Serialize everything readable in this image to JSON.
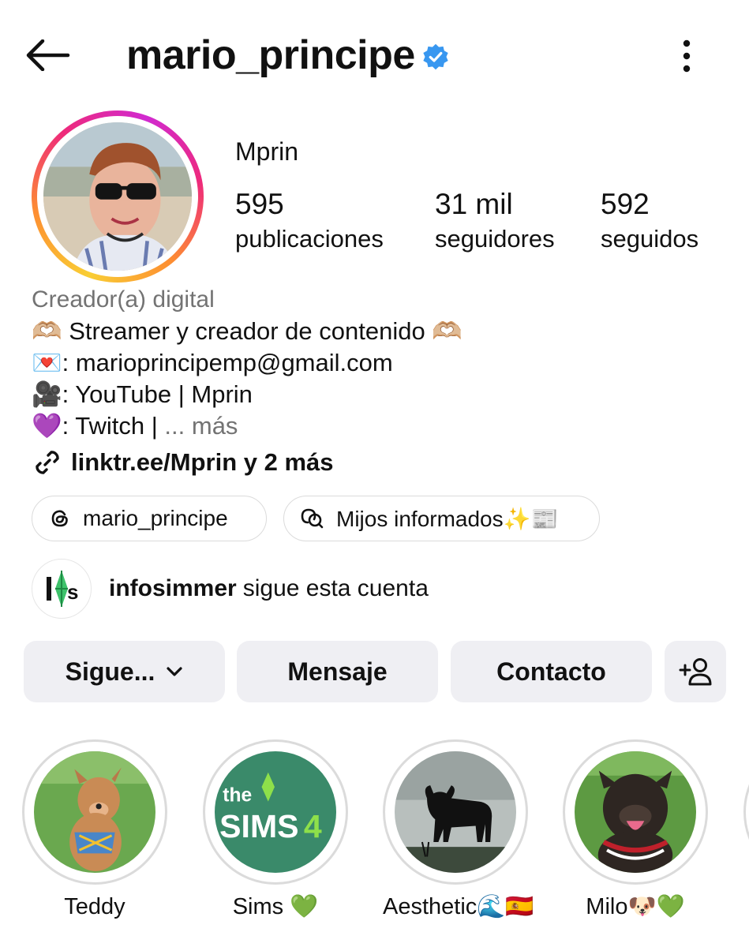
{
  "header": {
    "username": "mario_principe",
    "verified_icon": "verified-badge-icon",
    "back_icon": "arrow-left-icon",
    "more_icon": "more-vertical-icon"
  },
  "profile": {
    "display_name": "Mprin",
    "stats": {
      "posts": {
        "value": "595",
        "label": "publicaciones"
      },
      "followers": {
        "value": "31 mil",
        "label": "seguidores"
      },
      "following": {
        "value": "592",
        "label": "seguidos"
      }
    }
  },
  "bio": {
    "category": "Creador(a) digital",
    "line1_emoji_start": "🫶🏼",
    "line1_text": " Streamer y creador de contenido ",
    "line1_emoji_end": "🫶🏼",
    "line2_emoji": "💌",
    "line2_text": ": marioprincipemp@gmail.com",
    "line3_emoji": "🎥",
    "line3_text": ": YouTube | Mprin",
    "line4_emoji": "💜",
    "line4_text": ": Twitch | ",
    "more_label": "... más",
    "link_text": "linktr.ee/Mprin y 2 más"
  },
  "chips": {
    "threads_label": "mario_principe",
    "channel_label": "Mijos informados✨📰"
  },
  "followed_by": {
    "name": "infosimmer",
    "text": "sigue esta cuenta"
  },
  "actions": {
    "following_label": "Sigue...",
    "message_label": "Mensaje",
    "contact_label": "Contacto"
  },
  "highlights": [
    {
      "label": "Teddy"
    },
    {
      "label": "Sims 💚"
    },
    {
      "label": "Aesthetic🌊🇪🇸"
    },
    {
      "label": "Milo🐶💚"
    }
  ],
  "colors": {
    "verified_blue": "#3897f0",
    "button_bg": "#efeff3",
    "muted_text": "#737373",
    "sims_green": "#3a8a6a"
  }
}
